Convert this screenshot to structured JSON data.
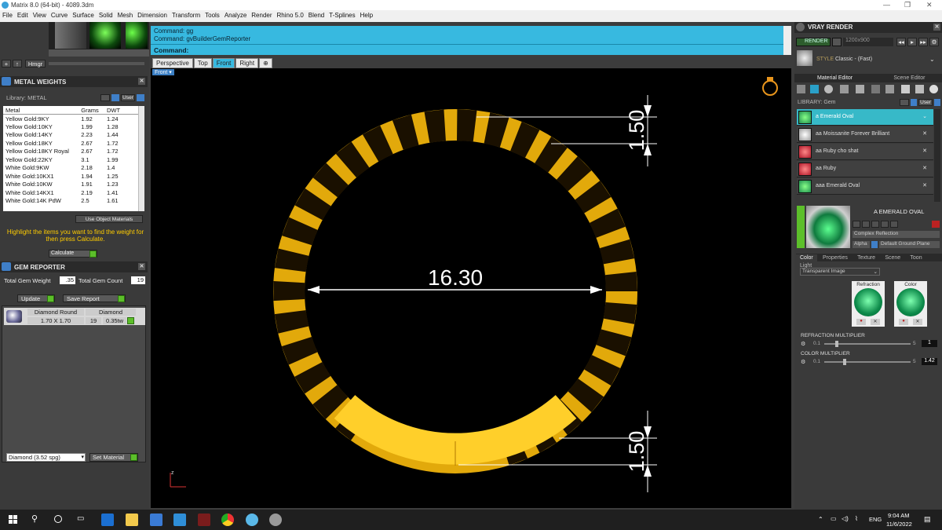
{
  "window": {
    "title": "Matrix 8.0 (64-bit) - 4089.3dm",
    "min": "—",
    "max": "❐",
    "close": "✕"
  },
  "menu": [
    "File",
    "Edit",
    "View",
    "Curve",
    "Surface",
    "Solid",
    "Mesh",
    "Dimension",
    "Transform",
    "Tools",
    "Analyze",
    "Render",
    "Rhino 5.0",
    "Blend",
    "T-Splines",
    "Help"
  ],
  "toolbar": {
    "hmgr_label": "Hmgr"
  },
  "metal_weights": {
    "title": "METAL WEIGHTS",
    "library_label": "Library: METAL",
    "user_label": "User",
    "columns": [
      "Metal",
      "Grams",
      "DWT"
    ],
    "rows": [
      [
        "Yellow Gold:9KY",
        "1.92",
        "1.24"
      ],
      [
        "Yellow Gold:10KY",
        "1.99",
        "1.28"
      ],
      [
        "Yellow Gold:14KY",
        "2.23",
        "1.44"
      ],
      [
        "Yellow Gold:18KY",
        "2.67",
        "1.72"
      ],
      [
        "Yellow Gold:18KY Royal",
        "2.67",
        "1.72"
      ],
      [
        "Yellow Gold:22KY",
        "3.1",
        "1.99"
      ],
      [
        "White Gold:9KW",
        "2.18",
        "1.4"
      ],
      [
        "White Gold:10KX1",
        "1.94",
        "1.25"
      ],
      [
        "White Gold:10KW",
        "1.91",
        "1.23"
      ],
      [
        "White Gold:14KX1",
        "2.19",
        "1.41"
      ],
      [
        "White Gold:14K PdW",
        "2.5",
        "1.61"
      ]
    ],
    "use_object_materials": "Use Object Materials",
    "hint": "Highlight the items you want to find the weight for then press Calculate.",
    "calculate_label": "Calculate"
  },
  "gem_reporter": {
    "title": "GEM REPORTER",
    "total_weight_label": "Total Gem Weight",
    "total_weight_value": ".35",
    "total_count_label": "Total Gem Count",
    "total_count_value": "19",
    "update_label": "Update",
    "save_report_label": "Save Report",
    "gem_name": "Diamond Round",
    "gem_size": "1.70 X 1.70",
    "gem_type": "Diamond",
    "gem_count": "19",
    "gem_weight": "0.35tw",
    "material_select": "Diamond    (3.52 spg)",
    "set_material_label": "Set Material"
  },
  "command": {
    "line1": "Command: gg",
    "line2": "Command: gvBuilderGemReporter",
    "prompt": "Command:"
  },
  "view_tabs": [
    "Perspective",
    "Top",
    "Front",
    "Right"
  ],
  "active_view": "Front",
  "viewport_label": "Front",
  "dimensions": {
    "diameter": "16.30",
    "top_width": "1.50",
    "bottom_width": "1.50"
  },
  "axis_label": "z",
  "vray": {
    "title": "VRAY RENDER",
    "render_label": "RENDER",
    "resolution": "1200x900",
    "style_label": "STYLE",
    "style_value": "Classic - (Fast)",
    "tabs": [
      "Material Editor",
      "Scene Editor"
    ],
    "library_label": "LIBRARY: Gem",
    "user_label": "User",
    "materials": [
      {
        "name": "a Emerald Oval",
        "color": "#1f8f4e",
        "active": true
      },
      {
        "name": "aa Moissanite Forever Brilliant",
        "color": "#d8d8d8",
        "active": false
      },
      {
        "name": "aa Ruby cho shat",
        "color": "#b0182a",
        "active": false
      },
      {
        "name": "aa Ruby",
        "color": "#b0182a",
        "active": false
      },
      {
        "name": "aaa Emerald Oval",
        "color": "#1f8f4e",
        "active": false
      }
    ],
    "selected_name": "A EMERALD OVAL",
    "complex_reflection": "Complex Reflection",
    "alpha_label": "Alpha",
    "ground_plane": "Default Ground Plane",
    "sub_tabs": [
      "Color",
      "Properties",
      "Texture",
      "Scene",
      "Toon",
      "Light"
    ],
    "transparent_select": "Transparent Image",
    "refraction_label": "Refraction",
    "color_label": "Color",
    "refraction_multiplier_label": "REFRACTION MULTIPLIER",
    "refraction_min": "0.1",
    "refraction_max": "5",
    "refraction_value": "1",
    "color_multiplier_label": "COLOR MULTIPLIER",
    "color_min": "0.1",
    "color_max": "5",
    "color_value": "1.42"
  },
  "taskbar": {
    "time": "9:04 AM",
    "date": "11/6/2022",
    "lang": "ENG"
  }
}
